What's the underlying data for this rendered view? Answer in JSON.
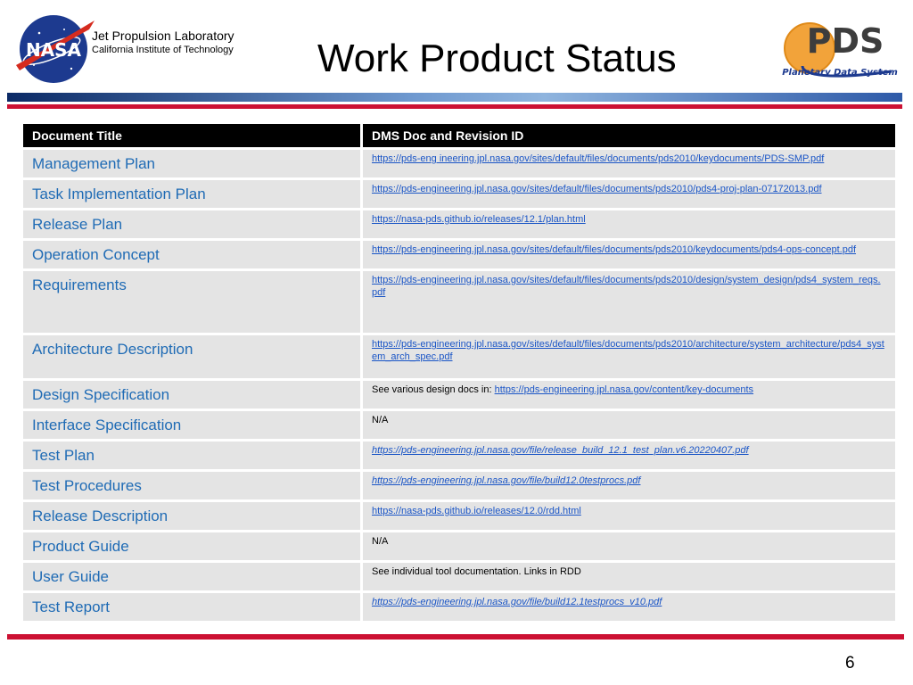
{
  "header": {
    "org_line1": "Jet Propulsion Laboratory",
    "org_line2": "California Institute of Technology",
    "title": "Work Product Status",
    "nasa_logo_text": "NASA",
    "pds_logo_text": "PDS",
    "pds_logo_subtitle": "Planetary Data System"
  },
  "table": {
    "col1_header": "Document Title",
    "col2_header": "DMS Doc and Revision ID",
    "rows": [
      {
        "title": "Management Plan",
        "link": "https://pds-eng ineering.jpl.nasa.gov/sites/default/files/documents/pds2010/keydocuments/PDS-SMP.pdf"
      },
      {
        "title": "Task Implementation Plan",
        "link": "https://pds-engineering.jpl.nasa.gov/sites/default/files/documents/pds2010/pds4-proj-plan-07172013.pdf"
      },
      {
        "title": "Release Plan",
        "link": "https://nasa-pds.github.io/releases/12.1/plan.html"
      },
      {
        "title": "Operation Concept",
        "link": "https://pds-engineering.jpl.nasa.gov/sites/default/files/documents/pds2010/keydocuments/pds4-ops-concept.pdf"
      },
      {
        "title": "Requirements",
        "link": "https://pds-engineering.jpl.nasa.gov/sites/default/files/documents/pds2010/design/system_design/pds4_system_reqs.pdf"
      },
      {
        "title": "Architecture Description",
        "link": "https://pds-engineering.jpl.nasa.gov/sites/default/files/documents/pds2010/architecture/system_architecture/pds4_system_arch_spec.pdf"
      },
      {
        "title": "Design Specification",
        "prefix": "See various design docs in: ",
        "link": "https://pds-engineering.jpl.nasa.gov/content/key-documents"
      },
      {
        "title": "Interface Specification",
        "text": "N/A"
      },
      {
        "title": "Test Plan",
        "link": "https://pds-engineering.jpl.nasa.gov/file/release_build_12.1_test_plan.v6.20220407.pdf"
      },
      {
        "title": "Test Procedures",
        "link": "https://pds-engineering.jpl.nasa.gov/file/build12.0testprocs.pdf"
      },
      {
        "title": "Release Description",
        "link": "https://nasa-pds.github.io/releases/12.0/rdd.html"
      },
      {
        "title": "Product Guide",
        "text": "N/A"
      },
      {
        "title": "User Guide",
        "text": "See individual tool documentation. Links in RDD"
      },
      {
        "title": "Test Report",
        "link": "https://pds-engineering.jpl.nasa.gov/file/build12.1testprocs_v10.pdf"
      }
    ]
  },
  "footer": {
    "page_number": "6"
  }
}
